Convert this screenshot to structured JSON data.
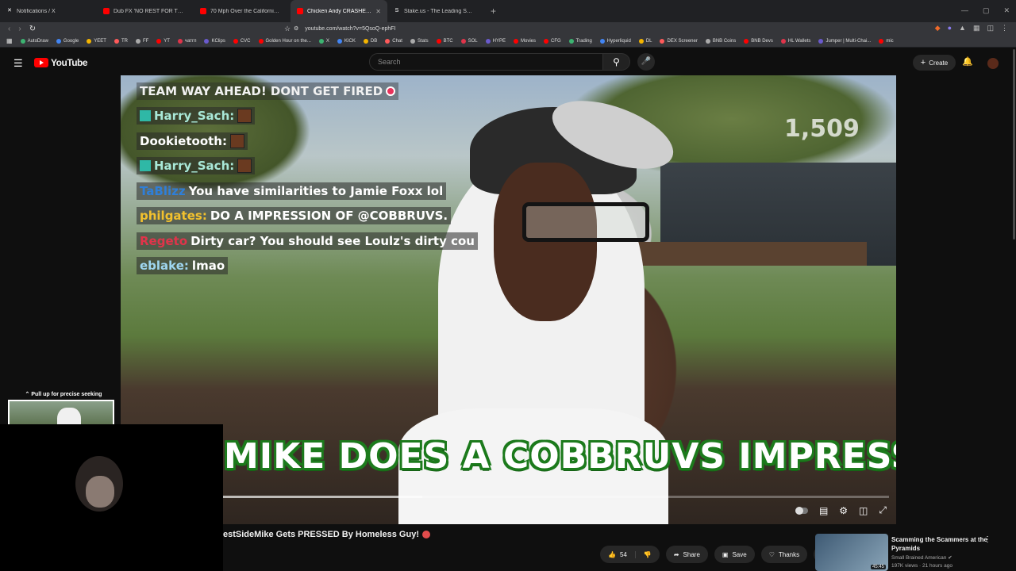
{
  "browser": {
    "tabs": [
      {
        "label": "Notifications / X",
        "icon": "x-logo-icon",
        "color": "#ffffff",
        "active": false
      },
      {
        "label": "Dub FX 'NO REST FOR THE WICKED'",
        "icon": "youtube-icon",
        "color": "#ff0000",
        "active": false
      },
      {
        "label": "70 Mph Over the California Coast //",
        "icon": "youtube-icon",
        "color": "#ff0000",
        "active": false
      },
      {
        "label": "Chicken Andy CRASHES Nic",
        "icon": "youtube-icon",
        "color": "#ff0000",
        "active": true
      },
      {
        "label": "Stake.us - The Leading Social Casino",
        "icon": "stake-icon",
        "color": "#ffffff",
        "active": false
      }
    ],
    "new_tab": "+",
    "url": "youtube.com/watch?v=5QsoQ-ephFI",
    "bookmarks": [
      "AutoDraw",
      "Google",
      "YEET",
      "TR",
      "FF",
      "YT",
      "чатгп",
      "KClips",
      "CVC",
      "Golden Hour on the...",
      "X",
      "KICK",
      "DB",
      "Chat",
      "Stats",
      "BTC",
      "SOL",
      "HYPE",
      "Movies",
      "CFG",
      "Trading",
      "Hyperliquid",
      "DL",
      "DEX Screener",
      "BNB Coins",
      "BNB Devs",
      "HL Wallets",
      "Jumper | Multi-Chai...",
      "mic"
    ]
  },
  "youtube": {
    "logo_text": "YouTube",
    "search_placeholder": "Search",
    "create_label": "Create",
    "brand_color": "#ff0000"
  },
  "video": {
    "chat_header": "TEAM WAY AHEAD! DONT GET FIRED",
    "chat": [
      {
        "user": "Harry_Sach:",
        "message": "",
        "user_color": "#a9e8d8",
        "badge": true,
        "emote": true
      },
      {
        "user": "Dookietooth:",
        "message": "",
        "user_color": "#ffffff",
        "badge": false,
        "emote": true
      },
      {
        "user": "Harry_Sach:",
        "message": "",
        "user_color": "#a9e8d8",
        "badge": true,
        "emote": true
      },
      {
        "user": "TaBlizz",
        "message": "You have similarities to Jamie Foxx lol",
        "user_color": "#2f7fd8",
        "badge": false,
        "emote": false
      },
      {
        "user": "philgates:",
        "message": "DO A IMPRESSION OF @COBBRUVS.",
        "user_color": "#f2c12e",
        "badge": false,
        "emote": false
      },
      {
        "user": "Regeto",
        "message": "Dirty car? You should see Loulz's dirty cou",
        "user_color": "#e0344a",
        "badge": false,
        "emote": false
      },
      {
        "user": "eblake:",
        "message": "lmao",
        "user_color": "#9fd6f0",
        "badge": false,
        "emote": false
      }
    ],
    "viewer_count": "1,509",
    "caption": "MIKE DOES A COBBRUVS IMPRESSION...",
    "progress_fraction": 0.3,
    "seek_hint": "Pull up for precise seeking",
    "title": "estSideMike Gets PRESSED By Homeless Guy!"
  },
  "actions": {
    "like_count": "54",
    "share_label": "Share",
    "save_label": "Save",
    "thanks_label": "Thanks",
    "more_label": "..."
  },
  "recommendation": {
    "title": "Scamming the Scammers at the Pyramids",
    "channel": "Small Brained American",
    "meta": "197K views · 21 hours ago",
    "duration": "45:45"
  }
}
